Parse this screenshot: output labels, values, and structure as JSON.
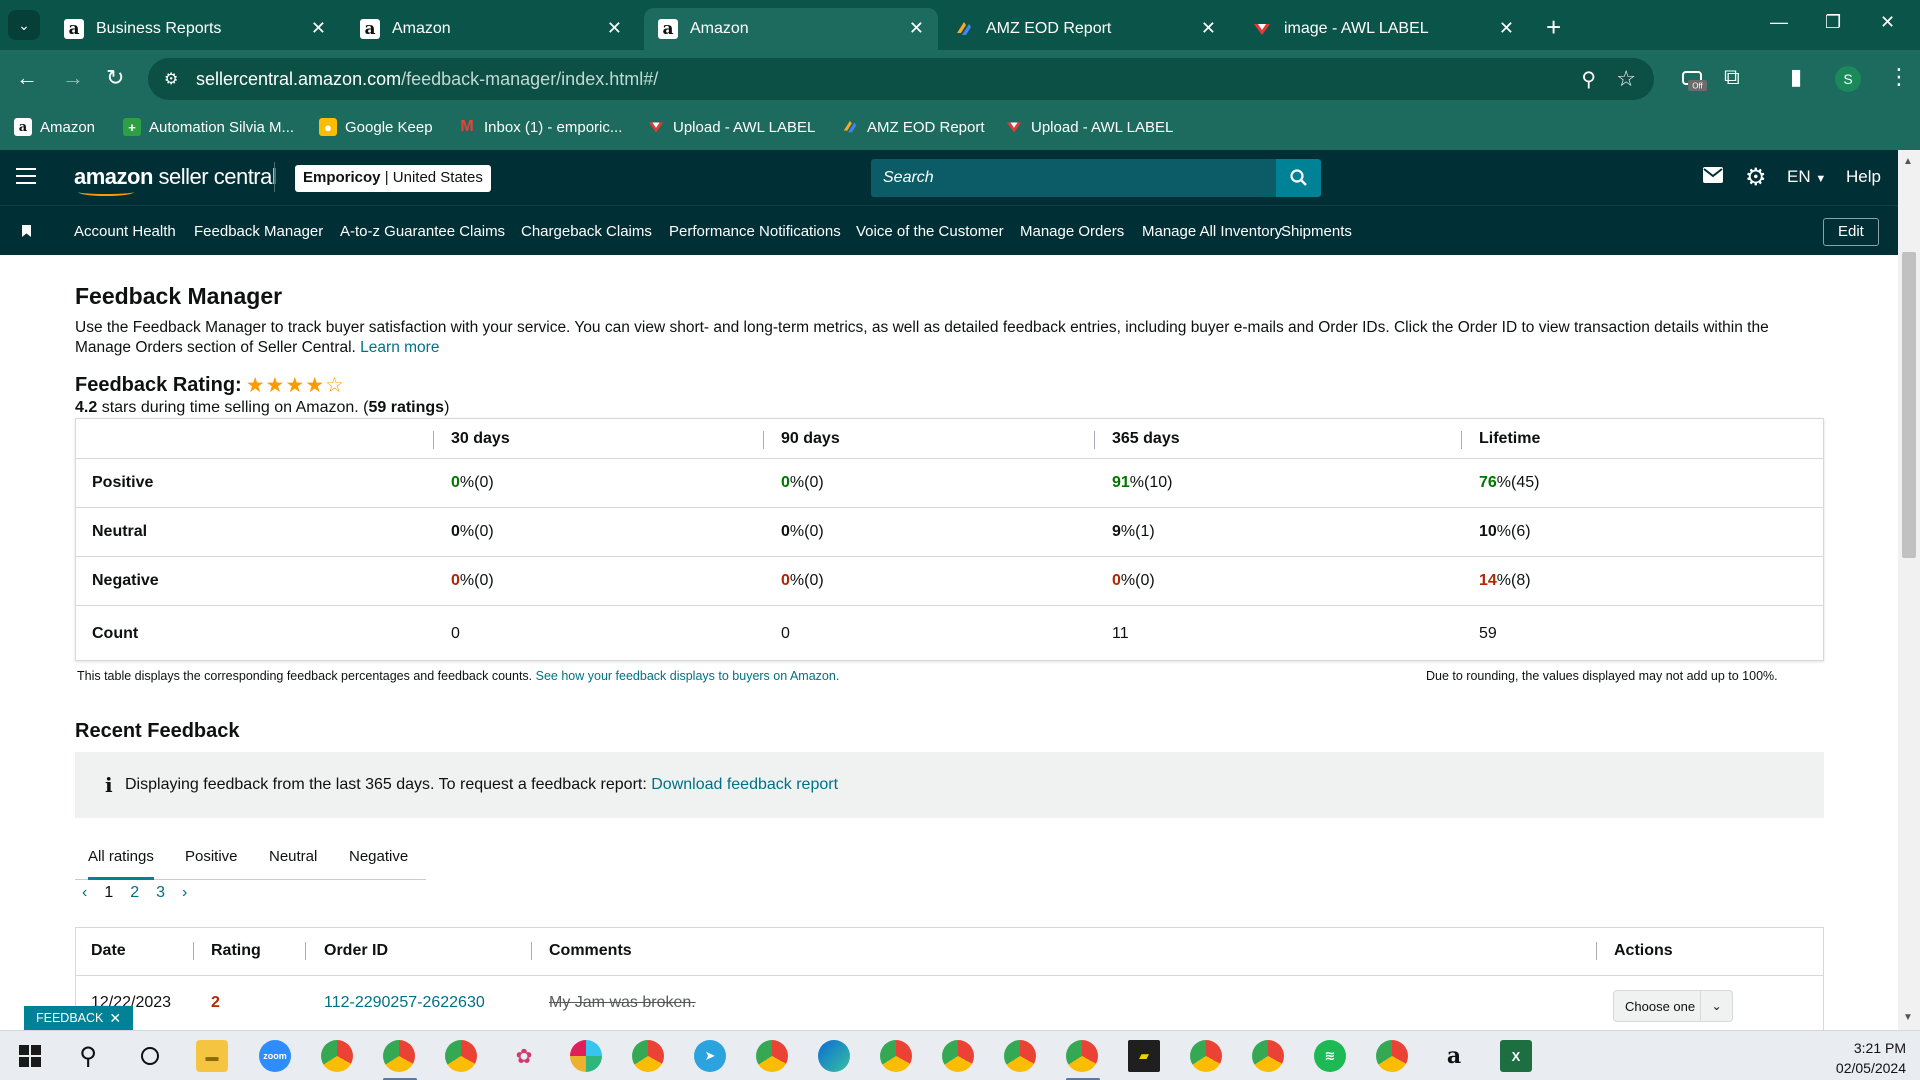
{
  "browser": {
    "tabs": [
      {
        "title": "Business Reports",
        "icon": "amazon-icon"
      },
      {
        "title": "Amazon",
        "icon": "amazon-icon"
      },
      {
        "title": "Amazon",
        "icon": "amazon-icon",
        "active": true
      },
      {
        "title": "AMZ EOD Report",
        "icon": "zapier-icon"
      },
      {
        "title": "image - AWL LABEL",
        "icon": "awl-icon"
      }
    ],
    "url_host": "sellercentral.amazon.com",
    "url_path": "/feedback-manager/index.html#/",
    "profile_initial": "S",
    "extension_badge": "Off",
    "bookmarks": [
      "Amazon",
      "Automation Silvia M...",
      "Google Keep",
      "Inbox (1) - emporic...",
      "Upload - AWL LABEL",
      "AMZ EOD Report",
      "Upload - AWL LABEL"
    ]
  },
  "header": {
    "logo_bold": "amazon",
    "logo_text": " seller central",
    "store_name": "Emporicoy",
    "store_region": "United States",
    "search_placeholder": "Search",
    "language": "EN",
    "help": "Help"
  },
  "nav": {
    "links": [
      "Account Health",
      "Feedback Manager",
      "A-to-z Guarantee Claims",
      "Chargeback Claims",
      "Performance Notifications",
      "Voice of the Customer",
      "Manage Orders",
      "Manage All Inventory",
      "Shipments"
    ],
    "edit": "Edit"
  },
  "page": {
    "title": "Feedback Manager",
    "description": "Use the Feedback Manager to track buyer satisfaction with your service. You can view short- and long-term metrics, as well as detailed feedback entries, including buyer e-mails and Order IDs. Click the Order ID to view transaction details within the Manage Orders section of Seller Central.",
    "learn_more": "Learn more",
    "rating_label": "Feedback Rating:",
    "rating_value": 4.2,
    "rating_stars_filled": 4,
    "rating_score": "4.2",
    "rating_text": " stars during time selling on Amazon. (",
    "rating_count": "59 ratings",
    "rating_close": ")"
  },
  "feedback_table": {
    "columns": [
      "30 days",
      "90 days",
      "365 days",
      "Lifetime"
    ],
    "rows": [
      {
        "label": "Positive",
        "cells": [
          [
            "0",
            " %(0)"
          ],
          [
            "0",
            " %(0)"
          ],
          [
            "91",
            " %(10)"
          ],
          [
            "76",
            " %(45)"
          ]
        ]
      },
      {
        "label": "Neutral",
        "cells": [
          [
            "0",
            " %(0)"
          ],
          [
            "0",
            " %(0)"
          ],
          [
            "9",
            " %(1)"
          ],
          [
            "10",
            " %(6)"
          ]
        ]
      },
      {
        "label": "Negative",
        "cells": [
          [
            "0",
            " %(0)"
          ],
          [
            "0",
            " %(0)"
          ],
          [
            "0",
            " %(0)"
          ],
          [
            "14",
            " %(8)"
          ]
        ]
      },
      {
        "label": "Count",
        "cells": [
          [
            "0",
            ""
          ],
          [
            "0",
            ""
          ],
          [
            "11",
            ""
          ],
          [
            "59",
            ""
          ]
        ]
      }
    ],
    "footnote": "This table displays the corresponding feedback percentages and feedback counts.",
    "footnote_link": "See how your feedback displays to buyers on Amazon.",
    "rounding_note": "Due to rounding, the values displayed may not add up to 100%."
  },
  "recent": {
    "title": "Recent Feedback",
    "info": "Displaying feedback from the last 365 days. To request a feedback report:",
    "info_link": "Download feedback report",
    "tabs": [
      "All ratings",
      "Positive",
      "Neutral",
      "Negative"
    ],
    "pages": [
      "1",
      "2",
      "3"
    ],
    "columns": [
      "Date",
      "Rating",
      "Order ID",
      "Comments",
      "Actions"
    ],
    "rows": [
      {
        "date": "12/22/2023",
        "rating": "2",
        "order_id": "112-2290257-2622630",
        "comment": "My Jam was broken.",
        "action": "Choose one"
      }
    ]
  },
  "feedback_widget": "FEEDBACK",
  "taskbar": {
    "time": "3:21 PM",
    "date": "02/05/2024"
  },
  "colors": {
    "chrome": "#0b5449",
    "header": "#002f36",
    "link": "#007185",
    "positive": "#007600",
    "negative": "#b12704",
    "star": "#ff9900"
  }
}
